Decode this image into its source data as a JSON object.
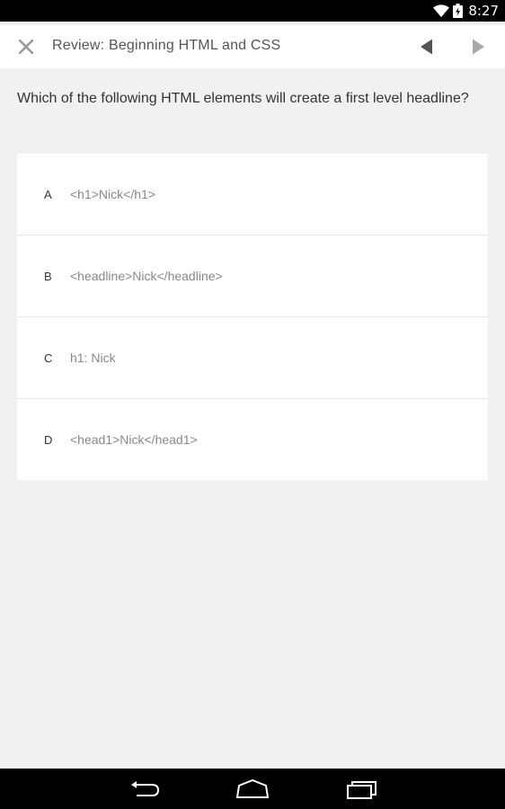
{
  "status_bar": {
    "time": "8:27",
    "icons": [
      "wifi-icon",
      "battery-charging-icon"
    ]
  },
  "header": {
    "close_icon": "close-icon",
    "title": "Review: Beginning HTML and CSS",
    "prev_icon": "triangle-left-icon",
    "next_icon": "triangle-right-icon"
  },
  "question": {
    "text": "Which of the following HTML elements will create a first level headline?"
  },
  "options": [
    {
      "letter": "A",
      "text": "<h1>Nick</h1>"
    },
    {
      "letter": "B",
      "text": "<headline>Nick</headline>"
    },
    {
      "letter": "C",
      "text": "h1: Nick"
    },
    {
      "letter": "D",
      "text": "<head1>Nick</head1>"
    }
  ],
  "nav_bar": {
    "icons": [
      "back-icon",
      "home-icon",
      "recent-apps-icon"
    ]
  },
  "colors": {
    "background": "#f1f1f1",
    "card": "#ffffff",
    "bars": "#000000",
    "icon_gray": "#9a9a9a"
  }
}
